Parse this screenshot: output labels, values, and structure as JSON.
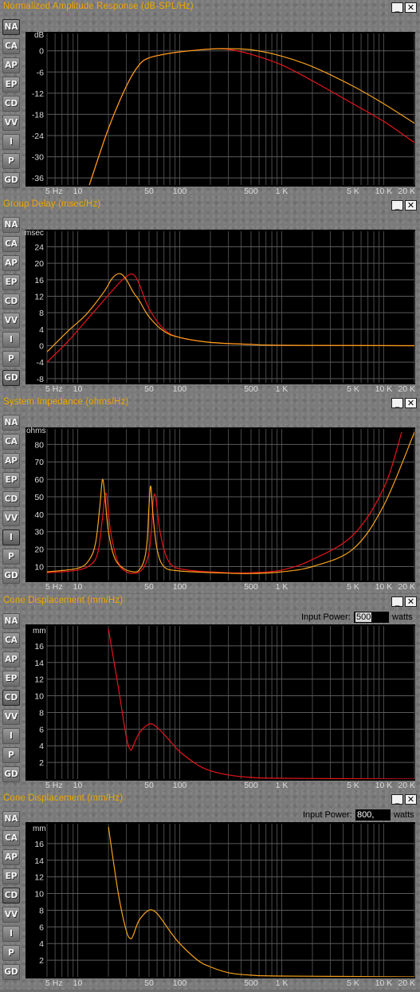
{
  "tab_labels": [
    "NA",
    "CA",
    "AP",
    "EP",
    "CD",
    "VV",
    "I",
    "P",
    "GD"
  ],
  "x_ticks": [
    {
      "f": 5,
      "label": "5 Hz"
    },
    {
      "f": 10,
      "label": "10"
    },
    {
      "f": 50,
      "label": "50"
    },
    {
      "f": 100,
      "label": "100"
    },
    {
      "f": 500,
      "label": "500"
    },
    {
      "f": 1000,
      "label": "1 K"
    },
    {
      "f": 5000,
      "label": "5 K"
    },
    {
      "f": 10000,
      "label": "10 K"
    },
    {
      "f": 20000,
      "label": "20 K"
    }
  ],
  "window_buttons": {
    "minimize": "_",
    "close": "✕"
  },
  "colors": {
    "panel": "#7a7a7a",
    "plot_bg": "#000000",
    "grid": "#555555",
    "title": "#f0a800",
    "series_red": "#e8141a",
    "series_orange": "#f7a21b"
  },
  "panels": [
    {
      "title": "Normalized Amplitude Response (dB-SPL/Hz)",
      "active_tab": "NA",
      "y_unit": "dB",
      "power": null,
      "chart_data": {
        "type": "line",
        "x_scale": "log",
        "xlim": [
          5,
          20000
        ],
        "ylim": [
          -38,
          4
        ],
        "yticks": [
          0,
          -6,
          -12,
          -18,
          -24,
          -30,
          -36
        ],
        "ytick_labels": [
          "0",
          "-6",
          "-12",
          "-18",
          "-24",
          "-30",
          "-36"
        ],
        "series": [
          {
            "color": "#e8141a",
            "x": [
              13,
              20,
              30,
              40,
              50,
              70,
              100,
              200,
              300,
              500,
              1000,
              2000,
              5000,
              10000,
              20000
            ],
            "y": [
              -38,
              -22,
              -10,
              -4,
              -2,
              -1,
              -0.3,
              0.5,
              0.4,
              -1,
              -4,
              -8.5,
              -15,
              -20,
              -26
            ]
          },
          {
            "color": "#f7a21b",
            "x": [
              13,
              20,
              30,
              40,
              50,
              70,
              100,
              200,
              300,
              500,
              1000,
              2000,
              5000,
              10000,
              20000
            ],
            "y": [
              -38,
              -22,
              -10,
              -4,
              -2,
              -1,
              -0.3,
              0.5,
              0.6,
              0.3,
              -1.5,
              -4.5,
              -10,
              -15,
              -20.5
            ]
          }
        ]
      }
    },
    {
      "title": "Group Delay (msec/Hz)",
      "active_tab": "GD",
      "y_unit": "msec",
      "power": null,
      "chart_data": {
        "type": "line",
        "x_scale": "log",
        "xlim": [
          5,
          20000
        ],
        "ylim": [
          -9,
          27
        ],
        "yticks": [
          24,
          20,
          16,
          12,
          8,
          4,
          0,
          -4,
          -8
        ],
        "ytick_labels": [
          "24",
          "20",
          "16",
          "12",
          "8",
          "4",
          "0",
          "-4",
          "-8"
        ],
        "series": [
          {
            "color": "#e8141a",
            "x": [
              5,
              8,
              12,
              18,
              25,
              30,
              35,
              40,
              50,
              70,
              100,
              200,
              500,
              1000,
              20000
            ],
            "y": [
              -4,
              1,
              6,
              11,
              15,
              16.8,
              17.3,
              15,
              9,
              4,
              2,
              0.8,
              0.3,
              0.1,
              0
            ]
          },
          {
            "color": "#f7a21b",
            "x": [
              5,
              8,
              12,
              18,
              22,
              26,
              30,
              35,
              40,
              50,
              70,
              100,
              200,
              500,
              1000,
              20000
            ],
            "y": [
              -1.5,
              3.5,
              7.5,
              13,
              16.5,
              17.5,
              16,
              13,
              11,
              7,
              3.5,
              2,
              0.8,
              0.3,
              0.1,
              0
            ]
          }
        ]
      }
    },
    {
      "title": "System Impedance (ohms/Hz)",
      "active_tab": "I",
      "y_unit": "ohms",
      "power": null,
      "chart_data": {
        "type": "line",
        "x_scale": "log",
        "xlim": [
          5,
          20000
        ],
        "ylim": [
          2,
          87
        ],
        "yticks": [
          80,
          70,
          60,
          50,
          40,
          30,
          20,
          10
        ],
        "ytick_labels": [
          "80",
          "70",
          "60",
          "50",
          "40",
          "30",
          "20",
          "10"
        ],
        "series": [
          {
            "color": "#e8141a",
            "x": [
              5,
              10,
              14,
              16,
              17.5,
              19,
              21,
              25,
              30,
              35,
              40,
              45,
              50,
              53,
              55,
              58,
              65,
              80,
              120,
              300,
              500,
              1000,
              2000,
              5000,
              10000,
              15000
            ],
            "y": [
              6.5,
              8,
              12,
              20,
              38,
              52,
              30,
              12,
              7,
              6,
              7,
              10,
              18,
              32,
              48,
              50,
              28,
              12,
              8,
              6.5,
              6.5,
              8,
              14,
              28,
              55,
              87
            ]
          },
          {
            "color": "#f7a21b",
            "x": [
              5,
              10,
              13,
              15,
              16.5,
              17.5,
              18.5,
              20,
              23,
              28,
              35,
              40,
              45,
              48,
              50,
              52,
              55,
              60,
              70,
              100,
              300,
              500,
              1000,
              2000,
              5000,
              10000,
              20000
            ],
            "y": [
              7,
              9,
              14,
              24,
              45,
              60,
              50,
              30,
              15,
              9,
              7,
              8,
              14,
              25,
              45,
              56,
              38,
              20,
              10,
              7.5,
              6.2,
              6,
              7,
              10,
              20,
              45,
              87
            ]
          }
        ]
      }
    },
    {
      "title": "Cone Displacement (mm/Hz)",
      "active_tab": "CD",
      "y_unit": "mm",
      "power": {
        "label": "Input Power:",
        "value": "500",
        "unit": "watts",
        "selected": true
      },
      "chart_data": {
        "type": "line",
        "x_scale": "log",
        "xlim": [
          5,
          20000
        ],
        "ylim": [
          0,
          18
        ],
        "yticks": [
          16,
          14,
          12,
          10,
          8,
          6,
          4,
          2
        ],
        "ytick_labels": [
          "16",
          "14",
          "12",
          "10",
          "8",
          "6",
          "4",
          "2"
        ],
        "series": [
          {
            "color": "#e8141a",
            "x": [
              20,
              25,
              30,
              33,
              35,
              40,
              50,
              60,
              80,
              100,
              150,
              200,
              300,
              500,
              1000,
              20000
            ],
            "y": [
              18,
              11,
              5,
              3.5,
              4,
              5.5,
              6.6,
              6.2,
              4.6,
              3.3,
              1.7,
              1,
              0.5,
              0.2,
              0.1,
              0
            ]
          }
        ]
      }
    },
    {
      "title": "Cone Displacement (mm/Hz)",
      "active_tab": "CD",
      "y_unit": "mm",
      "power": {
        "label": "Input Power:",
        "value": "800,",
        "unit": "watts",
        "selected": false
      },
      "chart_data": {
        "type": "line",
        "x_scale": "log",
        "xlim": [
          5,
          20000
        ],
        "ylim": [
          0,
          18
        ],
        "yticks": [
          16,
          14,
          12,
          10,
          8,
          6,
          4,
          2
        ],
        "ytick_labels": [
          "16",
          "14",
          "12",
          "10",
          "8",
          "6",
          "4",
          "2"
        ],
        "series": [
          {
            "color": "#f7a21b",
            "x": [
              20,
              25,
              30,
              33,
              35,
              40,
              50,
              60,
              80,
              100,
              150,
              200,
              300,
              500,
              1000,
              20000
            ],
            "y": [
              18,
              10,
              5.5,
              4.6,
              5,
              6.8,
              8,
              7.6,
              5.5,
              4,
              2,
              1.2,
              0.5,
              0.2,
              0.1,
              0
            ]
          }
        ]
      }
    }
  ]
}
